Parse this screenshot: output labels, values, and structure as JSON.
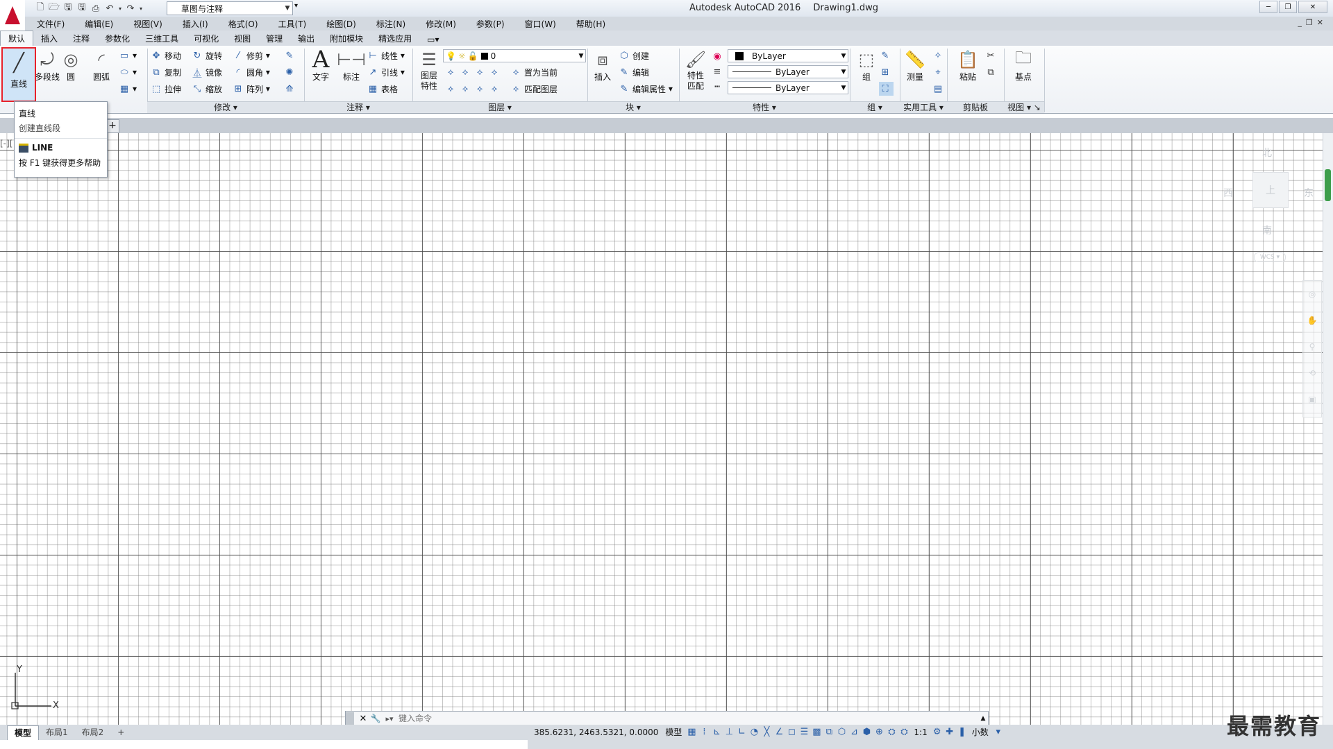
{
  "window": {
    "app_title": "Autodesk AutoCAD 2016",
    "document": "Drawing1.dwg",
    "workspace": "草图与注释"
  },
  "menu": [
    "文件(F)",
    "编辑(E)",
    "视图(V)",
    "插入(I)",
    "格式(O)",
    "工具(T)",
    "绘图(D)",
    "标注(N)",
    "修改(M)",
    "参数(P)",
    "窗口(W)",
    "帮助(H)"
  ],
  "ribbon_tabs": [
    "默认",
    "插入",
    "注释",
    "参数化",
    "三维工具",
    "可视化",
    "视图",
    "管理",
    "输出",
    "附加模块",
    "精选应用"
  ],
  "draw": {
    "line": "直线",
    "polyline": "多段线",
    "circle": "圆",
    "arc": "圆弧"
  },
  "modify": {
    "move": "移动",
    "rotate": "旋转",
    "trim": "修剪",
    "copy": "复制",
    "mirror": "镜像",
    "fillet": "圆角",
    "stretch": "拉伸",
    "scale": "缩放",
    "array": "阵列",
    "title": "修改"
  },
  "annotation": {
    "text": "文字",
    "dimension": "标注",
    "linear": "线性",
    "leader": "引线",
    "table": "表格",
    "title": "注释"
  },
  "layers": {
    "properties_1": "图层",
    "properties_2": "特性",
    "current_layer": "0",
    "make_current": "置为当前",
    "match": "匹配图层",
    "title": "图层"
  },
  "block": {
    "insert": "插入",
    "create": "创建",
    "edit": "编辑",
    "edit_attr": "编辑属性",
    "title": "块"
  },
  "properties": {
    "match_1": "特性",
    "match_2": "匹配",
    "color": "ByLayer",
    "linetype": "ByLayer",
    "lineweight": "ByLayer",
    "title": "特性"
  },
  "groups": {
    "group": "组",
    "title": "组"
  },
  "utilities": {
    "measure": "测量",
    "title": "实用工具"
  },
  "clipboard": {
    "paste": "粘贴",
    "title": "剪贴板"
  },
  "view_panel": {
    "base": "基点",
    "title": "视图"
  },
  "tooltip": {
    "title": "直线",
    "desc": "创建直线段",
    "command": "LINE",
    "help": "按 F1 键获得更多帮助"
  },
  "viewcube": {
    "north": "北",
    "south": "南",
    "east": "东",
    "west": "西",
    "top": "上",
    "wcs": "WCS"
  },
  "ucs": {
    "x": "X",
    "y": "Y"
  },
  "command": {
    "placeholder": "键入命令"
  },
  "layout_tabs": [
    "模型",
    "布局1",
    "布局2"
  ],
  "status": {
    "coords": "385.6231, 2463.5321, 0.0000",
    "mode": "模型",
    "scale": "1:1",
    "units": "小数"
  },
  "watermark": "最需教育"
}
